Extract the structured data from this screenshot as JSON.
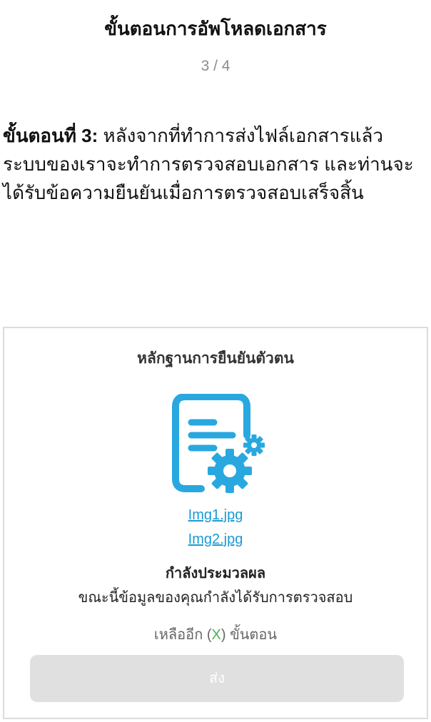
{
  "header": {
    "title": "ขั้นตอนการอัพโหลดเอกสาร",
    "step_counter": "3 / 4"
  },
  "step": {
    "label": "ขั้นตอนที่ 3:",
    "description": " หลังจากที่ทำการส่งไฟล์เอกสารแล้ว ระบบของเราจะทำการตรวจสอบเอกสาร และท่านจะได้รับข้อความยืนยันเมื่อการตรวจสอบเสร็จสิ้น"
  },
  "card": {
    "title": "หลักฐานการยืนยันตัวตน",
    "icon": "document-settings-icon",
    "files": [
      "Img1.jpg",
      "Img2.jpg"
    ],
    "status_title": "กำลังประมวลผล",
    "status_message": "ขณะนี้ข้อมูลของคุณกำลังได้รับการตรวจสอบ",
    "remaining_prefix": "เหลืออีก (",
    "remaining_value": "X",
    "remaining_suffix": ") ขั้นตอน",
    "submit_label": "ส่ง"
  },
  "colors": {
    "accent": "#29a8e0",
    "link": "#1a9ad6",
    "remaining_value": "#4caf50",
    "button_disabled_bg": "#e0e0e0",
    "step_counter": "#8c8c8c"
  }
}
